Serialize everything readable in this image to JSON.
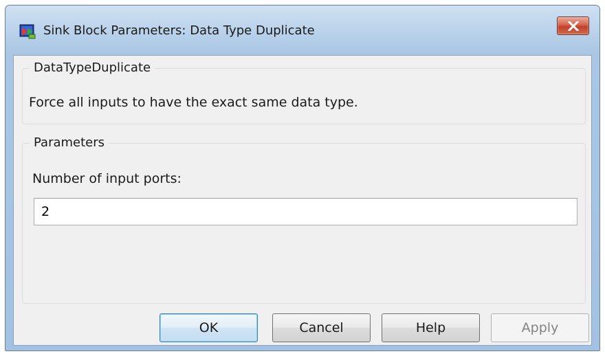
{
  "window": {
    "title": "Sink Block Parameters: Data Type Duplicate"
  },
  "description_group": {
    "legend": "DataTypeDuplicate",
    "text": "Force all inputs to have the exact same data type."
  },
  "parameters_group": {
    "legend": "Parameters",
    "input_ports_label": "Number of input ports:",
    "input_ports_value": "2"
  },
  "buttons": {
    "ok": "OK",
    "cancel": "Cancel",
    "help": "Help",
    "apply": "Apply"
  },
  "icons": {
    "app": "simulink-block-icon",
    "close": "close-icon"
  },
  "colors": {
    "close_button": "#c2402a",
    "default_button_border": "#3c7fb1",
    "disabled_text": "#838383"
  }
}
